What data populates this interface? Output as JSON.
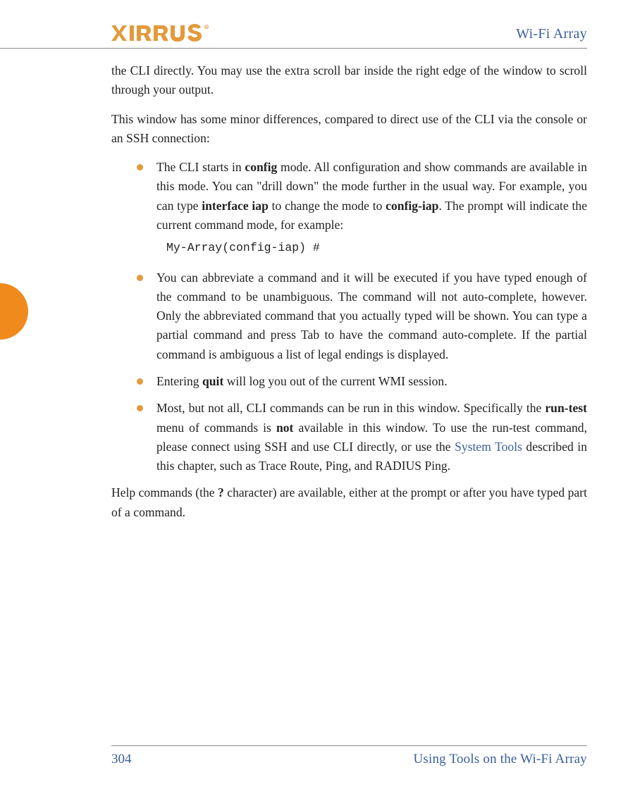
{
  "header": {
    "title": "Wi-Fi Array"
  },
  "body": {
    "para1": "the CLI directly. You may use the extra scroll bar inside the right edge of the window to scroll through your output.",
    "para2": "This window has some minor differences, compared to direct use of the CLI via the console or an SSH connection:",
    "bullets": {
      "b1": {
        "pre": "The CLI starts in ",
        "bold1": "config",
        "mid1": " mode. All configuration and show commands are available in this mode. You can \"drill down\" the mode further in the usual way. For example, you can type ",
        "bold2": "interface iap",
        "mid2": " to change the mode to ",
        "bold3": "config-iap",
        "tail": ". The prompt will indicate the current command mode, for example:",
        "code": "My-Array(config-iap) #"
      },
      "b2": "You can abbreviate a command and it will be executed if you have typed enough of the command to be unambiguous. The command will not auto-complete, however. Only the abbreviated command that you actually typed will be shown. You can type a partial command and press Tab to have the command auto-complete. If the partial command is ambiguous a list of legal endings is displayed.",
      "b3": {
        "pre": "Entering ",
        "bold": "quit",
        "tail": " will log you out of the current WMI session."
      },
      "b4": {
        "pre": "Most, but not all, CLI commands can be run in this window. Specifically the ",
        "bold1": "run-test",
        "mid1": " menu of commands is ",
        "bold2": "not",
        "mid2": " available in this window. To use the run-test command, please connect using SSH and use CLI directly, or use the ",
        "link": "System Tools",
        "tail": " described in this chapter, such as Trace Route, Ping, and RADIUS Ping."
      }
    },
    "para3": {
      "pre": "Help commands (the ",
      "bold": "?",
      "tail": " character) are available, either at the prompt or after you have typed part of a command."
    }
  },
  "footer": {
    "page": "304",
    "chapter": "Using Tools on the Wi-Fi Array"
  }
}
